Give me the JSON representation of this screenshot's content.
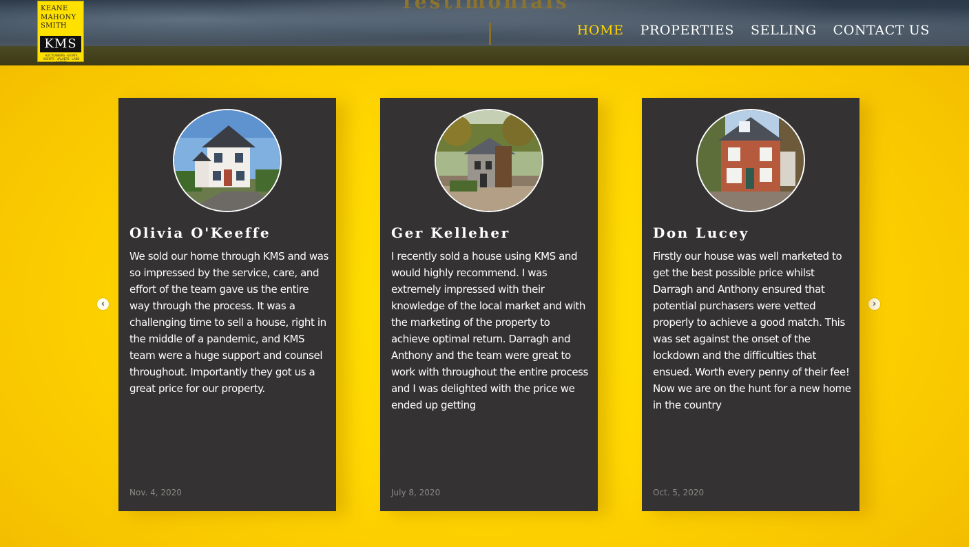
{
  "header": {
    "hero_title": "Testimonials",
    "logo": {
      "line1": "KEANE",
      "line2": "MAHONY",
      "line3": "SMITH",
      "mark": "KMS",
      "tagline": "AUCTIONEERS · ESTATE AGENTS · VALUERS · LAND AGENTS"
    },
    "nav": [
      {
        "label": "HOME",
        "active": true
      },
      {
        "label": "PROPERTIES",
        "active": false
      },
      {
        "label": "SELLING",
        "active": false
      },
      {
        "label": "CONTACT US",
        "active": false
      }
    ]
  },
  "carousel": {
    "prev_icon": "chevron-left-icon",
    "next_icon": "chevron-right-icon",
    "testimonials": [
      {
        "name": "Olivia O'Keeffe",
        "text": "We sold our home through KMS and was so impressed by the service, care, and effort of the team gave us the entire way through the process. It was a challenging time to sell a house, right in the middle of a pandemic, and KMS team were a huge support and counsel throughout. Importantly they got us a great price for our property.",
        "date": "Nov. 4, 2020"
      },
      {
        "name": "Ger Kelleher",
        "text": "I recently sold a house using KMS and would highly recommend. I was extremely impressed with their knowledge of the local market and with the marketing of the property to achieve optimal return. Darragh and Anthony and the team were great to work with throughout the entire process and I was delighted with the price we ended up getting",
        "date": "July 8, 2020"
      },
      {
        "name": "Don Lucey",
        "text": "Firstly our house was well marketed to get the best possible price whilst Darragh and Anthony ensured that potential purchasers were vetted properly to achieve a good match. This was set against the onset of the lockdown and the difficulties that ensued. Worth every penny of their fee! Now we are on the hunt for a new home in the country",
        "date": "Oct. 5, 2020"
      }
    ]
  },
  "colors": {
    "accent": "#ffd400",
    "card_bg": "#343233",
    "page_bg": "#ffd600"
  }
}
